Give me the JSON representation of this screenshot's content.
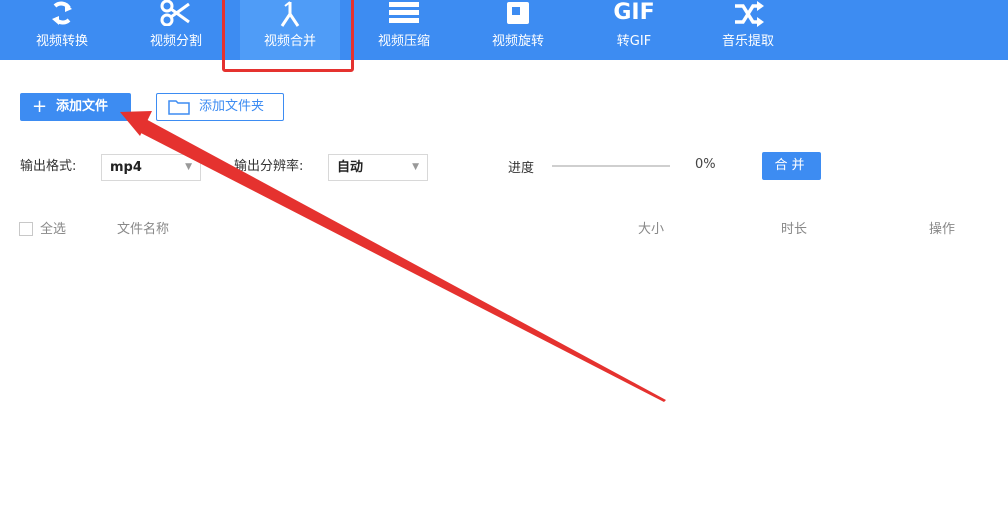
{
  "toolbar": {
    "items": [
      {
        "label": "视频转换",
        "icon": "convert-icon"
      },
      {
        "label": "视频分割",
        "icon": "scissors-icon"
      },
      {
        "label": "视频合并",
        "icon": "merge-icon",
        "active": true
      },
      {
        "label": "视频压缩",
        "icon": "compress-icon"
      },
      {
        "label": "视频旋转",
        "icon": "rotate-icon"
      },
      {
        "label": "转GIF",
        "icon": "gif-icon",
        "icon_text": "GIF"
      },
      {
        "label": "音乐提取",
        "icon": "shuffle-icon"
      }
    ],
    "bg_color": "#3d8cf2"
  },
  "actions": {
    "add_file": "添加文件",
    "add_folder": "添加文件夹"
  },
  "options": {
    "format_label": "输出格式:",
    "format_value": "mp4",
    "resolution_label": "输出分辨率:",
    "resolution_value": "自动",
    "progress_label": "进度",
    "progress_value": "0%",
    "merge_button": "合并"
  },
  "table": {
    "select_all": "全选",
    "columns": [
      "文件名称",
      "大小",
      "时长",
      "操作"
    ]
  },
  "annotation": {
    "highlight_color": "#e5322f"
  }
}
